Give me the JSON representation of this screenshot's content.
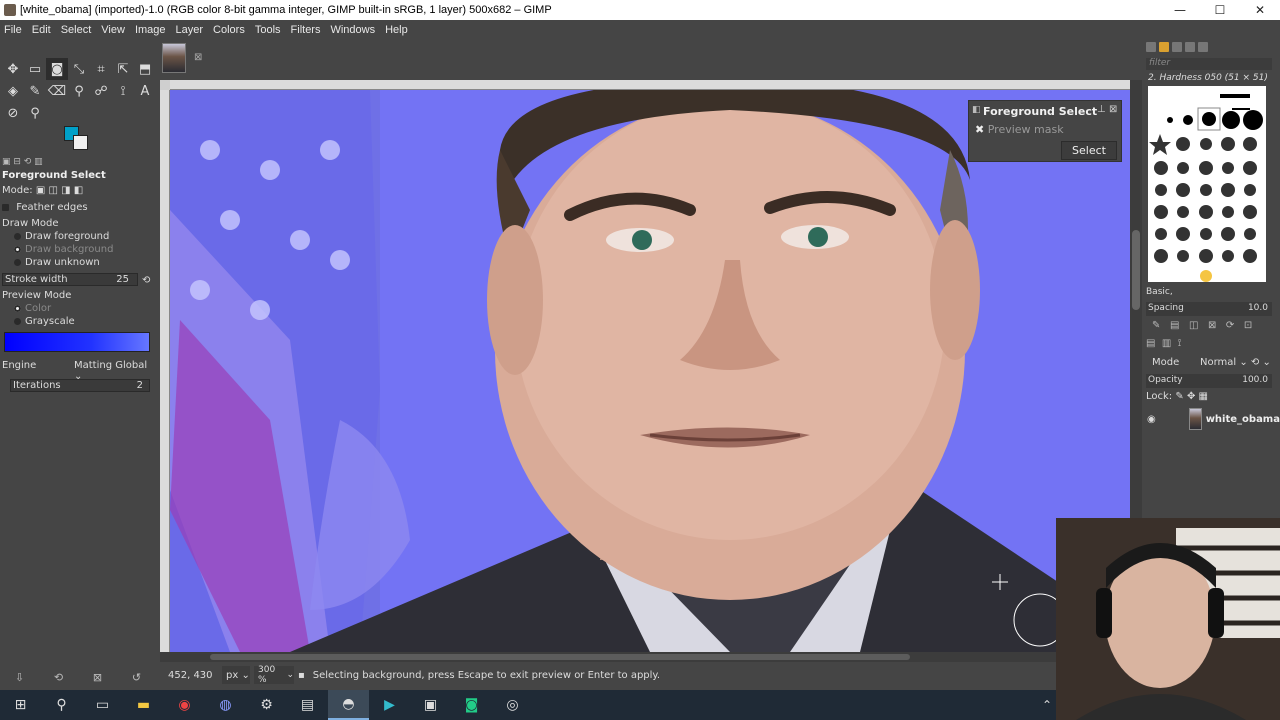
{
  "window": {
    "title": "[white_obama] (imported)-1.0 (RGB color 8-bit gamma integer, GIMP built-in sRGB, 1 layer) 500x682 – GIMP",
    "minimize": "—",
    "maximize": "☐",
    "close": "✕"
  },
  "menu": [
    "File",
    "Edit",
    "Select",
    "View",
    "Image",
    "Layer",
    "Colors",
    "Tools",
    "Filters",
    "Windows",
    "Help"
  ],
  "tool_options": {
    "title": "Foreground Select",
    "mode_label": "Mode:",
    "feather_edges": "Feather edges",
    "draw_mode_label": "Draw Mode",
    "draw_foreground": "Draw foreground",
    "draw_background": "Draw background",
    "draw_unknown": "Draw unknown",
    "stroke_width_label": "Stroke width",
    "stroke_width_value": "25",
    "preview_mode_label": "Preview Mode",
    "preview_color": "Color",
    "preview_grayscale": "Grayscale",
    "engine_label": "Engine",
    "engine_value": "Matting Global",
    "iterations_label": "Iterations",
    "iterations_value": "2",
    "mask_color": "#0000ff"
  },
  "fs_dialog": {
    "title": "Foreground Select",
    "preview_mask": "Preview mask",
    "select_button": "Select"
  },
  "statusbar": {
    "coords": "452, 430",
    "unit": "px",
    "zoom": "300 %",
    "message": "Selecting background, press Escape to exit preview or Enter to apply."
  },
  "brushes": {
    "filter_placeholder": "filter",
    "current_brush": "2. Hardness 050 (51 × 51)",
    "set": "Basic,",
    "spacing_label": "Spacing",
    "spacing_value": "10.0"
  },
  "layers": {
    "mode_label": "Mode",
    "mode_value": "Normal",
    "opacity_label": "Opacity",
    "opacity_value": "100.0",
    "lock_label": "Lock:",
    "layer_name": "white_obama"
  },
  "colors": {
    "foreground": "#00a0c8",
    "background": "#f0f0f0",
    "canvas_bg": "#7373f4"
  }
}
